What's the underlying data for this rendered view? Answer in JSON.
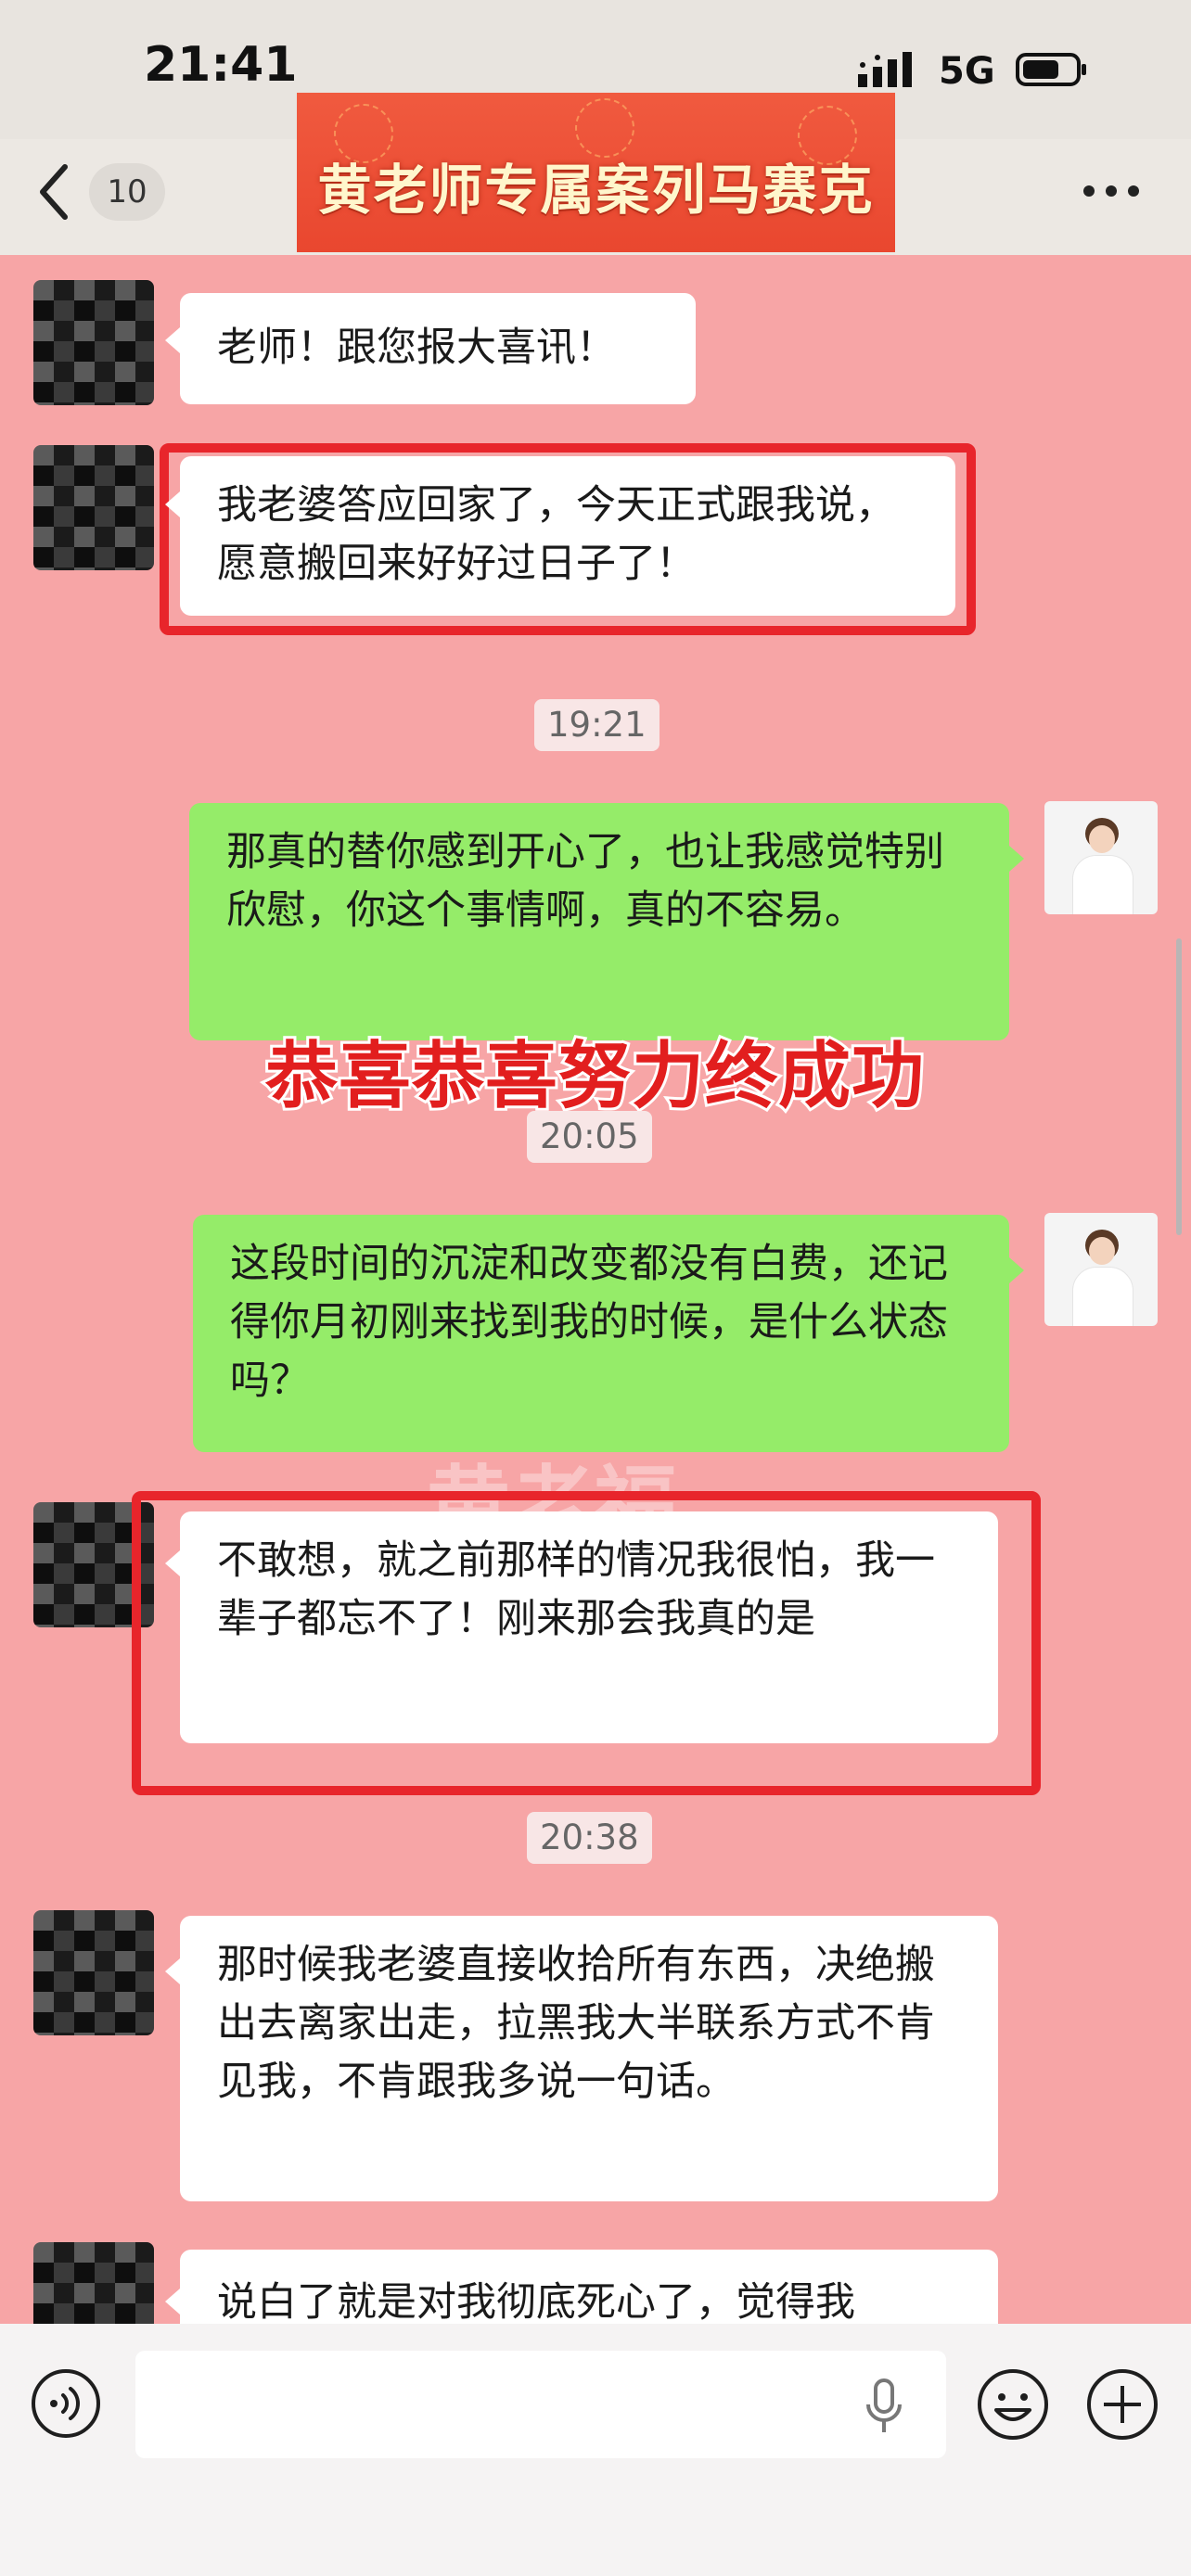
{
  "status_bar": {
    "time": "21:41",
    "network": "5G"
  },
  "header": {
    "back_count": "10",
    "banner_title": "黄老师专属案列马赛克"
  },
  "messages": [
    {
      "text": "老师！跟您报大喜讯！"
    },
    {
      "text": "我老婆答应回家了，今天正式跟我说，愿意搬回来好好过日子了！"
    },
    {
      "text": "那真的替你感到开心了，也让我感觉特别欣慰，你这个事情啊，真的不容易。"
    },
    {
      "text": "这段时间的沉淀和改变都没有白费，还记得你月初刚来找到我的时候，是什么状态吗？"
    },
    {
      "text": "不敢想，就之前那样的情况我很怕，我一辈子都忘不了！刚来那会我真的是"
    },
    {
      "text": "那时候我老婆直接收拾所有东西，决绝搬出去离家出走，拉黑我大半联系方式不肯见我，不肯跟我多说一句话。"
    },
    {
      "text": "说白了就是对我彻底死心了，觉得我"
    }
  ],
  "timestamps": [
    "19:21",
    "20:05",
    "20:38"
  ],
  "overlay": "恭喜恭喜努力终成功",
  "watermark": "黄老福",
  "colors": {
    "background": "#f7a5a6",
    "my_bubble": "#95ec69",
    "highlight_frame": "#e8252b",
    "banner": "#e9472f"
  },
  "icons": [
    "back-icon",
    "more-icon",
    "signal-icon",
    "battery-icon",
    "voice-icon",
    "mic-icon",
    "emoji-icon",
    "plus-icon"
  ]
}
